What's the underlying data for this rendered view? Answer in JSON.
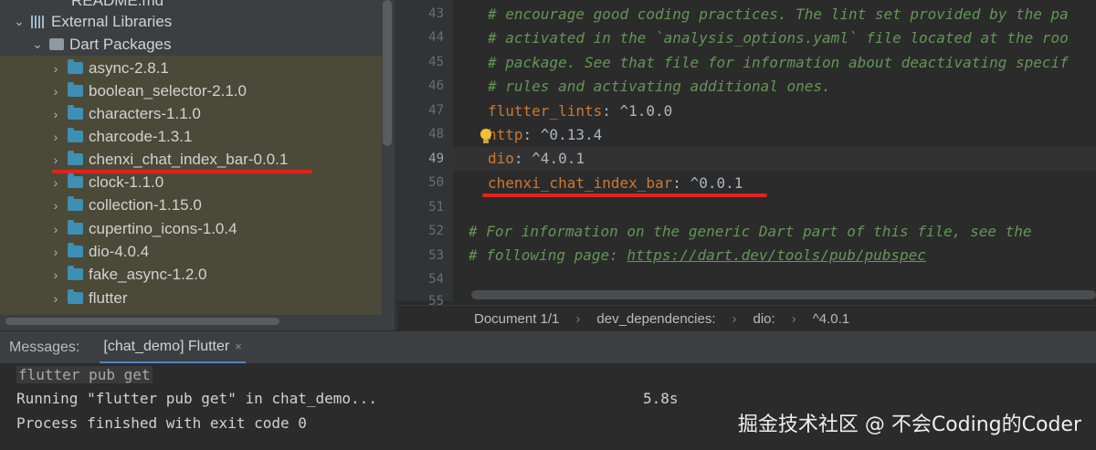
{
  "project_tree": {
    "top_partial": "README.md",
    "external_libraries": "External Libraries",
    "dart_packages": "Dart Packages",
    "packages": [
      "async-2.8.1",
      "boolean_selector-2.1.0",
      "characters-1.1.0",
      "charcode-1.3.1",
      "chenxi_chat_index_bar-0.0.1",
      "clock-1.1.0",
      "collection-1.15.0",
      "cupertino_icons-1.0.4",
      "dio-4.0.4",
      "fake_async-1.2.0",
      "flutter"
    ]
  },
  "editor": {
    "line_numbers": [
      "43",
      "44",
      "45",
      "46",
      "47",
      "48",
      "49",
      "50",
      "51",
      "52",
      "53",
      "54",
      "55"
    ],
    "lines": {
      "l43": "# encourage good coding practices. The lint set provided by the pa",
      "l44": "# activated in the `analysis_options.yaml` file located at the roo",
      "l45": "# package. See that file for information about deactivating specif",
      "l46": "# rules and activating additional ones.",
      "l47_key": "flutter_lints",
      "l47_val": ": ^1.0.0",
      "l48_key": "http",
      "l48_val": ": ^0.13.4",
      "l49_key": "dio",
      "l49_val": ": ^4.0.1",
      "l50_key": "chenxi_chat_index_bar",
      "l50_val": ": ^0.0.1",
      "l52": "# For information on the generic Dart part of this file, see the",
      "l53_prefix": "# following page: ",
      "l53_link": "https://dart.dev/tools/pub/pubspec"
    }
  },
  "breadcrumbs": {
    "document": "Document 1/1",
    "sep": "›",
    "section": "dev_dependencies:",
    "key": "dio:",
    "value": "^4.0.1"
  },
  "messages": {
    "label": "Messages:",
    "tab": "[chat_demo] Flutter",
    "close": "×"
  },
  "console": {
    "command": "flutter pub get",
    "running": "Running \"flutter pub get\" in chat_demo...",
    "time": "5.8s",
    "finished": "Process finished with exit code 0"
  },
  "watermark": "掘金技术社区 @ 不会Coding的Coder",
  "colors": {
    "underline_red": "#e3231b",
    "comment": "#629755",
    "yaml_key": "#cc7832"
  }
}
